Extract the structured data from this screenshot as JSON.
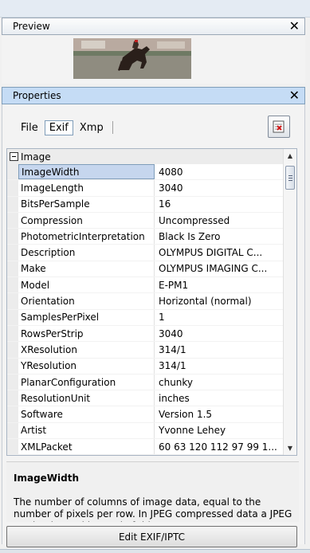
{
  "preview": {
    "title": "Preview",
    "close_label": "✕"
  },
  "properties": {
    "title": "Properties",
    "close_label": "✕",
    "tabs": [
      {
        "label": "File",
        "active": false
      },
      {
        "label": "Exif",
        "active": true
      },
      {
        "label": "Xmp",
        "active": false
      }
    ],
    "export_icon": "export-report-icon",
    "category": "Image",
    "rows": [
      {
        "name": "ImageWidth",
        "value": "4080",
        "selected": true
      },
      {
        "name": "ImageLength",
        "value": "3040"
      },
      {
        "name": "BitsPerSample",
        "value": "16"
      },
      {
        "name": "Compression",
        "value": "Uncompressed"
      },
      {
        "name": "PhotometricInterpretation",
        "value": "Black Is Zero"
      },
      {
        "name": "Description",
        "value": "OLYMPUS DIGITAL C..."
      },
      {
        "name": "Make",
        "value": "OLYMPUS IMAGING C..."
      },
      {
        "name": "Model",
        "value": "E-PM1"
      },
      {
        "name": "Orientation",
        "value": "Horizontal (normal)"
      },
      {
        "name": "SamplesPerPixel",
        "value": "1"
      },
      {
        "name": "RowsPerStrip",
        "value": "3040"
      },
      {
        "name": "XResolution",
        "value": "314/1"
      },
      {
        "name": "YResolution",
        "value": "314/1"
      },
      {
        "name": "PlanarConfiguration",
        "value": "chunky"
      },
      {
        "name": "ResolutionUnit",
        "value": "inches"
      },
      {
        "name": "Software",
        "value": "Version 1.5"
      },
      {
        "name": "Artist",
        "value": "Yvonne Lehey"
      },
      {
        "name": "XMLPacket",
        "value": "60 63 120 112 97 99 1..."
      }
    ]
  },
  "description": {
    "title": "ImageWidth",
    "text": "The number of columns of image data, equal to the number of pixels per row. In JPEG compressed data a JPEG marker is used instead of this tag."
  },
  "footer": {
    "edit_label": "Edit EXIF/IPTC"
  },
  "colors": {
    "header_selected": "#c5dcf5",
    "row_selected": "#c6d6ee"
  }
}
